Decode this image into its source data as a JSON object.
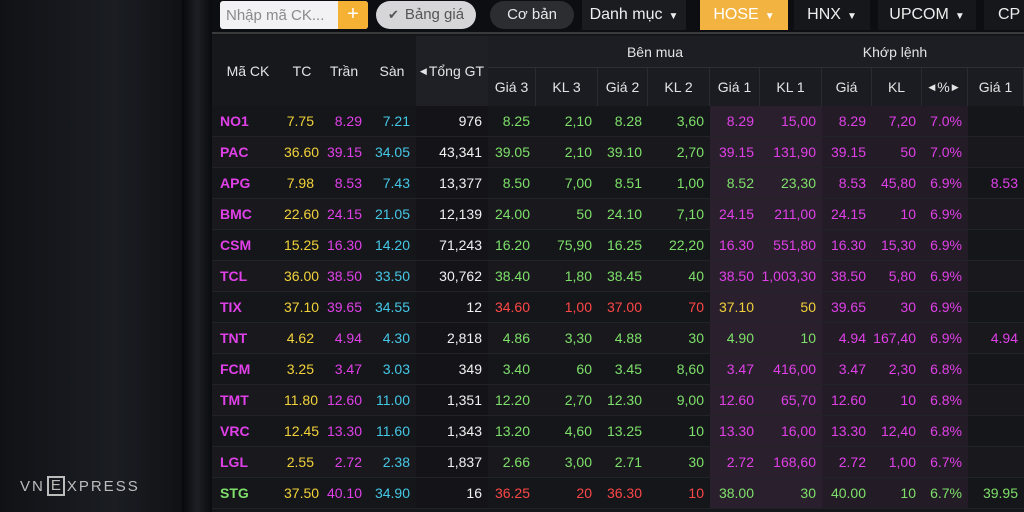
{
  "toolbar": {
    "search_placeholder": "Nhập mã CK...",
    "add_label": "+",
    "board_label": "Bảng giá",
    "basic_label": "Cơ bản",
    "category_label": "Danh mục",
    "exchanges": [
      "HOSE",
      "HNX",
      "UPCOM",
      "CP"
    ],
    "active_exchange": "HOSE"
  },
  "table": {
    "group_headers": {
      "buy": "Bên mua",
      "match": "Khớp lệnh"
    },
    "columns": {
      "symbol": "Mã CK",
      "ref": "TC",
      "ceil": "Trần",
      "floor": "Sàn",
      "total": "Tổng GT",
      "p3": "Giá 3",
      "v3": "KL 3",
      "p2": "Giá 2",
      "v2": "KL 2",
      "p1": "Giá 1",
      "v1": "KL 1",
      "m_price": "Giá",
      "m_vol": "KL",
      "m_pct": "%",
      "s_p1": "Giá 1"
    },
    "rows": [
      {
        "sym": "NO1",
        "ref": "7.75",
        "ceil": "8.29",
        "floor": "7.21",
        "total": "976",
        "p3": "8.25",
        "v3": "2,10",
        "p2": "8.28",
        "v2": "3,60",
        "p1": "8.29",
        "v1": "15,00",
        "mp": "8.29",
        "mv": "7,20",
        "pct": "7.0%",
        "sp1": "",
        "c": [
          "ceil",
          "ceil",
          "up",
          "up",
          "up",
          "up",
          "ceil",
          "ceil",
          "ceil",
          "ceil",
          "ceil",
          "ceil"
        ]
      },
      {
        "sym": "PAC",
        "ref": "36.60",
        "ceil": "39.15",
        "floor": "34.05",
        "total": "43,341",
        "p3": "39.05",
        "v3": "2,10",
        "p2": "39.10",
        "v2": "2,70",
        "p1": "39.15",
        "v1": "131,90",
        "mp": "39.15",
        "mv": "50",
        "pct": "7.0%",
        "sp1": "",
        "c": [
          "ceil",
          "ceil",
          "up",
          "up",
          "up",
          "up",
          "ceil",
          "ceil",
          "ceil",
          "ceil",
          "ceil",
          "ceil"
        ]
      },
      {
        "sym": "APG",
        "ref": "7.98",
        "ceil": "8.53",
        "floor": "7.43",
        "total": "13,377",
        "p3": "8.50",
        "v3": "7,00",
        "p2": "8.51",
        "v2": "1,00",
        "p1": "8.52",
        "v1": "23,30",
        "mp": "8.53",
        "mv": "45,80",
        "pct": "6.9%",
        "sp1": "8.53",
        "c": [
          "ceil",
          "ceil",
          "up",
          "up",
          "up",
          "up",
          "up",
          "up",
          "ceil",
          "ceil",
          "ceil",
          "ceil"
        ]
      },
      {
        "sym": "BMC",
        "ref": "22.60",
        "ceil": "24.15",
        "floor": "21.05",
        "total": "12,139",
        "p3": "24.00",
        "v3": "50",
        "p2": "24.10",
        "v2": "7,10",
        "p1": "24.15",
        "v1": "211,00",
        "mp": "24.15",
        "mv": "10",
        "pct": "6.9%",
        "sp1": "",
        "c": [
          "ceil",
          "ceil",
          "up",
          "up",
          "up",
          "up",
          "ceil",
          "ceil",
          "ceil",
          "ceil",
          "ceil",
          "ceil"
        ]
      },
      {
        "sym": "CSM",
        "ref": "15.25",
        "ceil": "16.30",
        "floor": "14.20",
        "total": "71,243",
        "p3": "16.20",
        "v3": "75,90",
        "p2": "16.25",
        "v2": "22,20",
        "p1": "16.30",
        "v1": "551,80",
        "mp": "16.30",
        "mv": "15,30",
        "pct": "6.9%",
        "sp1": "",
        "c": [
          "ceil",
          "ceil",
          "up",
          "up",
          "up",
          "up",
          "ceil",
          "ceil",
          "ceil",
          "ceil",
          "ceil",
          "ceil"
        ]
      },
      {
        "sym": "TCL",
        "ref": "36.00",
        "ceil": "38.50",
        "floor": "33.50",
        "total": "30,762",
        "p3": "38.40",
        "v3": "1,80",
        "p2": "38.45",
        "v2": "40",
        "p1": "38.50",
        "v1": "1,003,30",
        "mp": "38.50",
        "mv": "5,80",
        "pct": "6.9%",
        "sp1": "",
        "c": [
          "ceil",
          "ceil",
          "up",
          "up",
          "up",
          "up",
          "ceil",
          "ceil",
          "ceil",
          "ceil",
          "ceil",
          "ceil"
        ]
      },
      {
        "sym": "TIX",
        "ref": "37.10",
        "ceil": "39.65",
        "floor": "34.55",
        "total": "12",
        "p3": "34.60",
        "v3": "1,00",
        "p2": "37.00",
        "v2": "70",
        "p1": "37.10",
        "v1": "50",
        "mp": "39.65",
        "mv": "30",
        "pct": "6.9%",
        "sp1": "",
        "c": [
          "ceil",
          "ceil",
          "down",
          "down",
          "down",
          "down",
          "ref",
          "ref",
          "ceil",
          "ceil",
          "ceil",
          "ceil"
        ]
      },
      {
        "sym": "TNT",
        "ref": "4.62",
        "ceil": "4.94",
        "floor": "4.30",
        "total": "2,818",
        "p3": "4.86",
        "v3": "3,30",
        "p2": "4.88",
        "v2": "30",
        "p1": "4.90",
        "v1": "10",
        "mp": "4.94",
        "mv": "167,40",
        "pct": "6.9%",
        "sp1": "4.94",
        "c": [
          "ceil",
          "ceil",
          "up",
          "up",
          "up",
          "up",
          "up",
          "up",
          "ceil",
          "ceil",
          "ceil",
          "ceil"
        ]
      },
      {
        "sym": "FCM",
        "ref": "3.25",
        "ceil": "3.47",
        "floor": "3.03",
        "total": "349",
        "p3": "3.40",
        "v3": "60",
        "p2": "3.45",
        "v2": "8,60",
        "p1": "3.47",
        "v1": "416,00",
        "mp": "3.47",
        "mv": "2,30",
        "pct": "6.8%",
        "sp1": "",
        "c": [
          "ceil",
          "ceil",
          "up",
          "up",
          "up",
          "up",
          "ceil",
          "ceil",
          "ceil",
          "ceil",
          "ceil",
          "ceil"
        ]
      },
      {
        "sym": "TMT",
        "ref": "11.80",
        "ceil": "12.60",
        "floor": "11.00",
        "total": "1,351",
        "p3": "12.20",
        "v3": "2,70",
        "p2": "12.30",
        "v2": "9,00",
        "p1": "12.60",
        "v1": "65,70",
        "mp": "12.60",
        "mv": "10",
        "pct": "6.8%",
        "sp1": "",
        "c": [
          "ceil",
          "ceil",
          "up",
          "up",
          "up",
          "up",
          "ceil",
          "ceil",
          "ceil",
          "ceil",
          "ceil",
          "ceil"
        ]
      },
      {
        "sym": "VRC",
        "ref": "12.45",
        "ceil": "13.30",
        "floor": "11.60",
        "total": "1,343",
        "p3": "13.20",
        "v3": "4,60",
        "p2": "13.25",
        "v2": "10",
        "p1": "13.30",
        "v1": "16,00",
        "mp": "13.30",
        "mv": "12,40",
        "pct": "6.8%",
        "sp1": "",
        "c": [
          "ceil",
          "ceil",
          "up",
          "up",
          "up",
          "up",
          "ceil",
          "ceil",
          "ceil",
          "ceil",
          "ceil",
          "ceil"
        ]
      },
      {
        "sym": "LGL",
        "ref": "2.55",
        "ceil": "2.72",
        "floor": "2.38",
        "total": "1,837",
        "p3": "2.66",
        "v3": "3,00",
        "p2": "2.71",
        "v2": "30",
        "p1": "2.72",
        "v1": "168,60",
        "mp": "2.72",
        "mv": "1,00",
        "pct": "6.7%",
        "sp1": "",
        "c": [
          "ceil",
          "ceil",
          "up",
          "up",
          "up",
          "up",
          "ceil",
          "ceil",
          "ceil",
          "ceil",
          "ceil",
          "ceil"
        ]
      },
      {
        "sym": "STG",
        "ref": "37.50",
        "ceil": "40.10",
        "floor": "34.90",
        "total": "16",
        "p3": "36.25",
        "v3": "20",
        "p2": "36.30",
        "v2": "10",
        "p1": "38.00",
        "v1": "30",
        "mp": "40.00",
        "mv": "10",
        "pct": "6.7%",
        "sp1": "39.95",
        "c": [
          "up",
          "up",
          "down",
          "down",
          "down",
          "down",
          "up",
          "up",
          "up",
          "up",
          "up",
          "up"
        ]
      }
    ]
  },
  "watermark": {
    "prefix": "VN",
    "box": "E",
    "suffix": "XPRESS"
  }
}
